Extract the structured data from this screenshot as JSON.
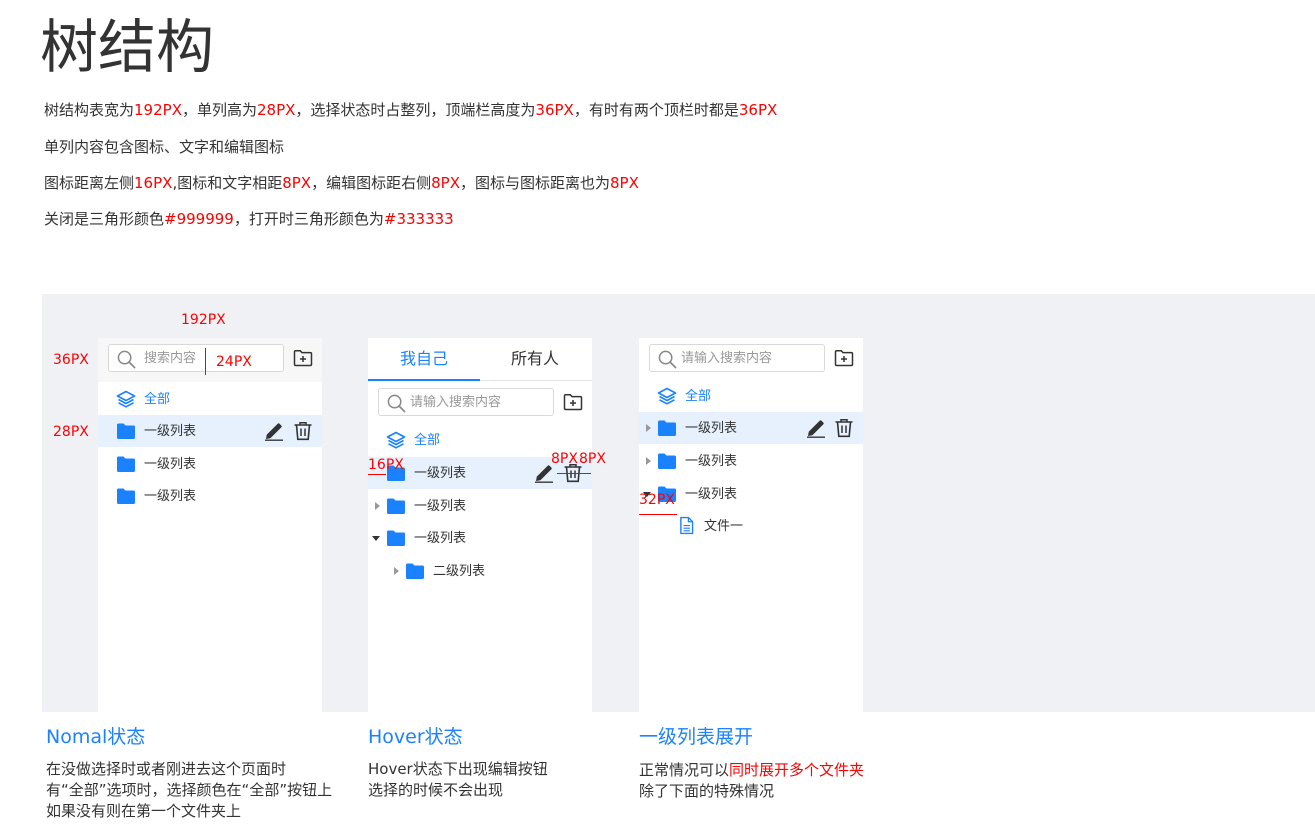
{
  "title": "树结构",
  "description": [
    [
      {
        "t": "树结构表宽为"
      },
      {
        "t": "192PX",
        "red": true
      },
      {
        "t": "，单列高为"
      },
      {
        "t": "28PX",
        "red": true
      },
      {
        "t": "，选择状态时占整列，顶端栏高度为"
      },
      {
        "t": "36PX",
        "red": true
      },
      {
        "t": "，有时有两个顶栏时都是"
      },
      {
        "t": "36PX",
        "red": true
      }
    ],
    [
      {
        "t": "单列内容包含图标、文字和编辑图标"
      }
    ],
    [
      {
        "t": "图标距离左侧"
      },
      {
        "t": "16PX",
        "red": true
      },
      {
        "t": ",图标和文字相距"
      },
      {
        "t": "8PX",
        "red": true
      },
      {
        "t": "，编辑图标距右侧"
      },
      {
        "t": "8PX",
        "red": true
      },
      {
        "t": "，图标与图标距离也为"
      },
      {
        "t": "8PX",
        "red": true
      }
    ],
    [
      {
        "t": "关闭是三角形颜色"
      },
      {
        "t": "#999999",
        "red": true
      },
      {
        "t": "，打开时三角形颜色为"
      },
      {
        "t": "#333333",
        "red": true
      }
    ]
  ],
  "colors": {
    "accent": "#1a82ff",
    "annotation": "#ff0000",
    "selected_bg": "#e6f1fd",
    "demo_bg": "#f0f1f5",
    "triangle_closed": "#999999",
    "triangle_open": "#333333"
  },
  "annotations": {
    "width": "192PX",
    "header_height": "36PX",
    "row_height": "28PX",
    "search_gap": "24PX",
    "left_padding": "16PX",
    "icon_gap": "8PX",
    "right_padding": "8PX",
    "indent": "32PX"
  },
  "normal_panel": {
    "search_placeholder": "搜索内容",
    "all_label": "全部",
    "rows": [
      "一级列表",
      "一级列表",
      "一级列表"
    ]
  },
  "hover_panel": {
    "tab_mine": "我自己",
    "tab_all": "所有人",
    "search_placeholder": "请输入搜索内容",
    "all_label": "全部",
    "rows": [
      "一级列表",
      "一级列表",
      "一级列表"
    ],
    "child_row": "二级列表"
  },
  "expand_panel": {
    "search_placeholder": "请输入搜索内容",
    "all_label": "全部",
    "rows": [
      "一级列表",
      "一级列表",
      "一级列表"
    ],
    "file_row": "文件一"
  },
  "captions": {
    "normal_title": "Nomal状态",
    "normal_lines": [
      "在没做选择时或者刚进去这个页面时",
      "有“全部”选项时，选择颜色在“全部”按钮上",
      "如果没有则在第一个文件夹上"
    ],
    "hover_title": "Hover状态",
    "hover_lines": [
      "Hover状态下出现编辑按钮",
      "选择的时候不会出现"
    ],
    "expand_title": "一级列表展开",
    "expand_line1_prefix": "正常情况可以",
    "expand_line1_highlight": "同时展开多个文件夹",
    "expand_line2": "除了下面的特殊情况"
  }
}
